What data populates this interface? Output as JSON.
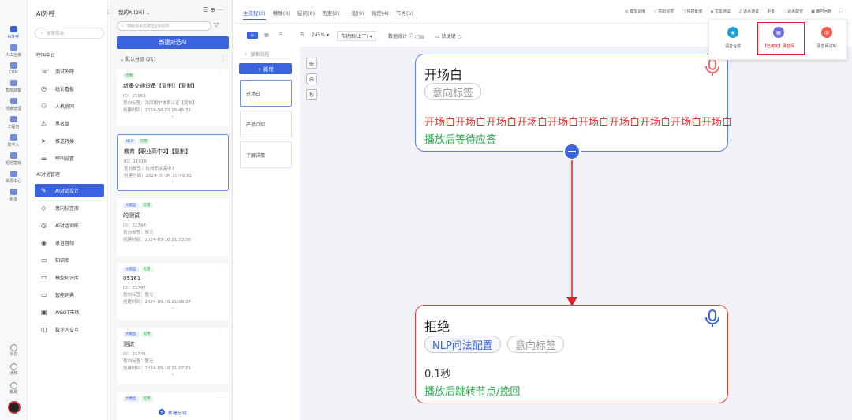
{
  "rail": {
    "items": [
      {
        "label": "AI外呼",
        "active": true
      },
      {
        "label": "人工坐席",
        "active": false
      },
      {
        "label": "CRM",
        "active": false
      },
      {
        "label": "智能获客",
        "active": false
      },
      {
        "label": "线索管理",
        "active": false
      },
      {
        "label": "工程包",
        "active": false
      },
      {
        "label": "数字人",
        "active": false
      },
      {
        "label": "短信营销",
        "active": false
      },
      {
        "label": "资源中心",
        "active": false
      },
      {
        "label": "更多",
        "active": false
      }
    ],
    "bottom": [
      "消息",
      "通知",
      "帮助"
    ]
  },
  "menu": {
    "title": "AI外呼",
    "search_placeholder": "搜索菜单",
    "section1": "呼叫中台",
    "items1": [
      {
        "icon": "phone-icon",
        "glyph": "☏",
        "label": "测试外呼"
      },
      {
        "icon": "clock-icon",
        "glyph": "◷",
        "label": "统计看板"
      },
      {
        "icon": "users-icon",
        "glyph": "⚇",
        "label": "人机协同"
      },
      {
        "icon": "warning-icon",
        "glyph": "⚠",
        "label": "黑名单"
      },
      {
        "icon": "send-icon",
        "glyph": "➤",
        "label": "推送转接"
      },
      {
        "icon": "settings-icon",
        "glyph": "☰",
        "label": "呼叫设置"
      }
    ],
    "section2": "AI对话管理",
    "items2": [
      {
        "icon": "edit-icon",
        "glyph": "✎",
        "label": "AI对话设计",
        "active": true
      },
      {
        "icon": "tag-icon",
        "glyph": "◇",
        "label": "意向标签库"
      },
      {
        "icon": "chat-icon",
        "glyph": "◎",
        "label": "AI对话训练"
      },
      {
        "icon": "audio-icon",
        "glyph": "◉",
        "label": "录音音频"
      },
      {
        "icon": "book-icon",
        "glyph": "▭",
        "label": "知识库"
      },
      {
        "icon": "model-icon",
        "glyph": "▭",
        "label": "模型知识库"
      },
      {
        "icon": "dict-icon",
        "glyph": "▭",
        "label": "智能词典"
      },
      {
        "icon": "market-icon",
        "glyph": "▣",
        "label": "AIBOT市场"
      },
      {
        "icon": "human-icon",
        "glyph": "◫",
        "label": "数字人交互"
      }
    ]
  },
  "list": {
    "header": "我的AI(26)",
    "search_placeholder": "搜索话术名称/ID/手机号",
    "new_button": "新建对话AI",
    "group_label": "默认分组",
    "group_count": "(21)",
    "add_group": "新建分组",
    "cards": [
      {
        "tags": [
          {
            "text": "可用",
            "color": "green"
          }
        ],
        "name": "新泰交通设备【复制】【复制】",
        "id": "ID：21953",
        "label_line": "意向标签：法雨银宁体系认证【复制】",
        "time_line": "创建时间：2024-06-03 16:46:32"
      },
      {
        "tags": [
          {
            "text": "NLP",
            "color": "blue"
          },
          {
            "text": "可用",
            "color": "green"
          }
        ],
        "name": "教育【职业高中2】【复制】",
        "id": "ID：21918",
        "label_line": "意向标签：杭州职业高中1",
        "time_line": "创建时间：2024-05-30 20:49:31"
      },
      {
        "tags": [
          {
            "text": "大模型",
            "color": "blue"
          },
          {
            "text": "可用",
            "color": "green"
          }
        ],
        "name": "的测试",
        "id": "ID：21748",
        "label_line": "意向标签：暂无",
        "time_line": "创建时间：2024-05-16 21:33:36"
      },
      {
        "tags": [
          {
            "text": "大模型",
            "color": "blue"
          },
          {
            "text": "可用",
            "color": "green"
          }
        ],
        "name": "05161",
        "id": "ID：21747",
        "label_line": "意向标签：暂无",
        "time_line": "创建时间：2024-05-16 21:08:37"
      },
      {
        "tags": [
          {
            "text": "大模型",
            "color": "blue"
          },
          {
            "text": "可用",
            "color": "green"
          }
        ],
        "name": "测试",
        "id": "ID：21746",
        "label_line": "意向标签：暂无",
        "time_line": "创建时间：2024-05-16 21:07:31"
      },
      {
        "tags": [
          {
            "text": "大模型",
            "color": "blue"
          },
          {
            "text": "可用",
            "color": "green"
          }
        ]
      }
    ]
  },
  "topbar": {
    "tabs": [
      {
        "label": "主流程(3)",
        "active": true
      },
      {
        "label": "特殊(8)"
      },
      {
        "label": "疑问(8)"
      },
      {
        "label": "否定(2)"
      },
      {
        "label": "一般(9)"
      },
      {
        "label": "肯定(4)"
      },
      {
        "label": "节点(5)"
      }
    ],
    "tools": [
      "模型训练",
      "意向标签",
      "快捷配置",
      "文本测试",
      "话术测试",
      "更多",
      "话术配音",
      "审可回稽"
    ]
  },
  "toolbar2": {
    "zoom": "245%",
    "layout": "布状图(上下)",
    "stat": "数据统计",
    "shortcut": "快捷键"
  },
  "nodes_panel": {
    "search_placeholder": "搜索流程",
    "add_label": "+ 新增",
    "items": [
      "开场白",
      "产品介绍",
      "了解详情"
    ]
  },
  "flow": {
    "node1": {
      "title": "开场白",
      "chip": "意向标签",
      "text": "开场白开场白开场白开场白开场白开场白开场白开场白开场白开场白",
      "action": "播放后等待应答"
    },
    "node2": {
      "title": "拒绝",
      "chip1": "NLP问法配置",
      "chip2": "意向标签",
      "duration": "0.1秒",
      "action": "播放后跳转节点/挽回"
    }
  },
  "popup": {
    "items": [
      {
        "label": "语音合成",
        "color": "#1aa0d8"
      },
      {
        "label": "【已绑定】录音师",
        "color": "#6c6cd8"
      },
      {
        "label": "录音师试听",
        "color": "#ef5a4a"
      }
    ]
  },
  "colors": {
    "accent": "#3a63e0",
    "red": "#e83030",
    "green": "#2aa94a"
  }
}
